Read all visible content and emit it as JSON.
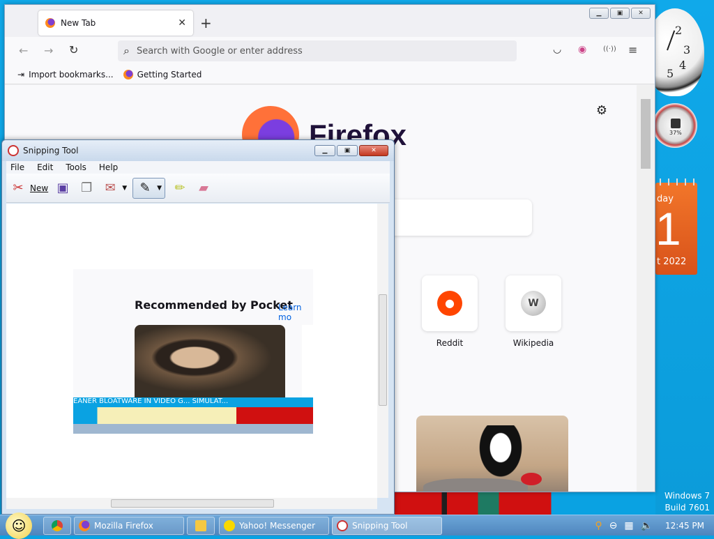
{
  "firefox": {
    "tab_title": "New Tab",
    "tab_close": "✕",
    "new_tab": "+",
    "url_placeholder": "Search with Google or enter address",
    "bookmarks": [
      "Import bookmarks...",
      "Getting Started"
    ],
    "wordmark": "Firefox",
    "tiles": [
      {
        "label": "Reddit",
        "icon": "reddit-icon"
      },
      {
        "label": "Wikipedia",
        "icon": "wikipedia-icon"
      }
    ]
  },
  "snipping_tool": {
    "title": "Snipping Tool",
    "menu": [
      "File",
      "Edit",
      "Tools",
      "Help"
    ],
    "new_label": "New",
    "capture": {
      "heading": "Recommended by Pocket",
      "learn_more": "Learn mo",
      "strip_text": "EANER    BLOATWARE   IN VIDEO G...                          SIMULAT..."
    }
  },
  "gadgets": {
    "clock_numbers": [
      "2",
      "3",
      "4",
      "5"
    ],
    "meter_pct": "37%",
    "calendar_day": "day",
    "calendar_date": "1",
    "calendar_year": "t 2022"
  },
  "os": {
    "version_line1": "Windows 7",
    "version_line2": "Build 7601",
    "time": "12:45 PM"
  },
  "taskbar": {
    "items": [
      {
        "label": "Mozilla Firefox",
        "icon": "firefox-icon"
      },
      {
        "label": "Yahoo! Messenger",
        "icon": "yahoo-messenger-icon"
      },
      {
        "label": "Snipping Tool",
        "icon": "snipping-tool-icon"
      }
    ]
  }
}
